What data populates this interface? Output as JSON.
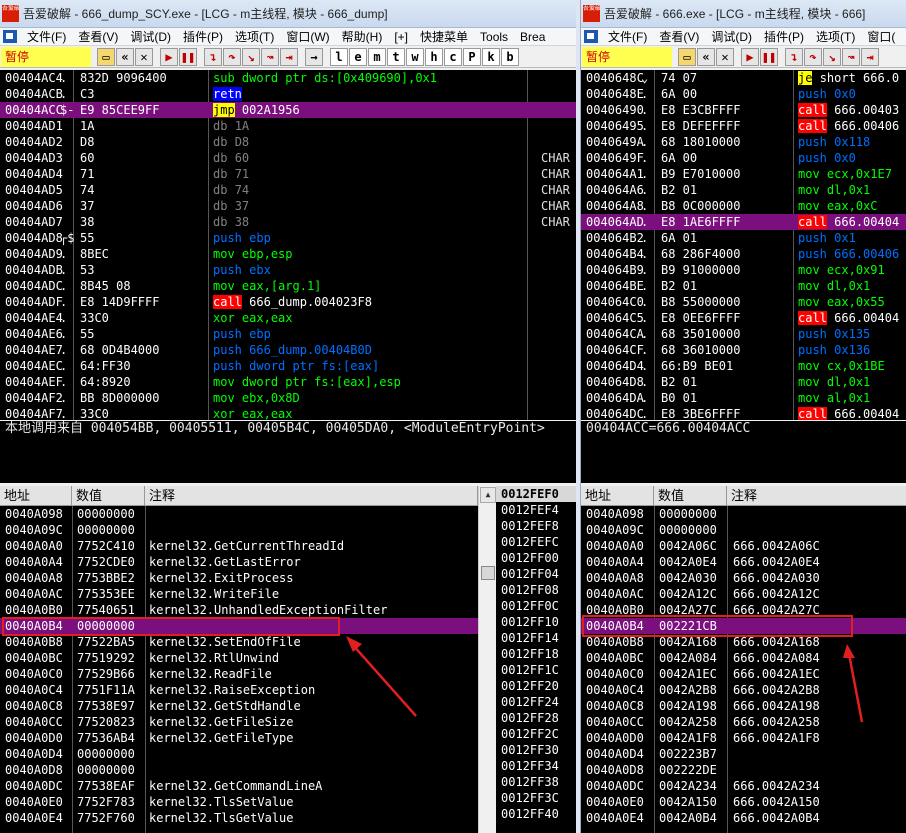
{
  "left": {
    "title": "吾爱破解 - 666_dump_SCY.exe - [LCG - m主线程, 模块 - 666_dump]",
    "logo_text": "吾爱破解",
    "menu": [
      "文件(F)",
      "查看(V)",
      "调试(D)",
      "插件(P)",
      "选项(T)",
      "窗口(W)",
      "帮助(H)",
      "[+]",
      "快捷菜单",
      "Tools",
      "Brea"
    ],
    "status": "暂停",
    "toolbar_letters": [
      "l",
      "e",
      "m",
      "t",
      "w",
      "h",
      "c",
      "P",
      "k",
      "b"
    ],
    "cpu_rows": [
      {
        "addr": "00404AC4",
        "mark": ".",
        "hex": "832D 9096400",
        "op": "sub",
        "args": "dword ptr ds:[0x409690],0x1",
        "cmt": ""
      },
      {
        "addr": "00404ACB",
        "mark": ".",
        "hex": "C3",
        "op": "retn",
        "args": "",
        "cmt": ""
      },
      {
        "addr": "00404ACC",
        "mark": "$-",
        "hex": "E9 85CEE9FF",
        "op": "jmp",
        "args": "002A1956",
        "cmt": ""
      },
      {
        "addr": "00404AD1",
        "mark": "",
        "hex": "1A",
        "op": "db",
        "args": "1A",
        "cmt": ""
      },
      {
        "addr": "00404AD2",
        "mark": "",
        "hex": "D8",
        "op": "db",
        "args": "D8",
        "cmt": ""
      },
      {
        "addr": "00404AD3",
        "mark": "",
        "hex": "60",
        "op": "db",
        "args": "60",
        "cmt": "CHAR"
      },
      {
        "addr": "00404AD4",
        "mark": "",
        "hex": "71",
        "op": "db",
        "args": "71",
        "cmt": "CHAR"
      },
      {
        "addr": "00404AD5",
        "mark": "",
        "hex": "74",
        "op": "db",
        "args": "74",
        "cmt": "CHAR"
      },
      {
        "addr": "00404AD6",
        "mark": "",
        "hex": "37",
        "op": "db",
        "args": "37",
        "cmt": "CHAR"
      },
      {
        "addr": "00404AD7",
        "mark": "",
        "hex": "38",
        "op": "db",
        "args": "38",
        "cmt": "CHAR"
      },
      {
        "addr": "00404AD8",
        "mark": "┌$",
        "hex": "55",
        "op": "push",
        "args": "ebp",
        "cmt": ""
      },
      {
        "addr": "00404AD9",
        "mark": ".",
        "hex": "8BEC",
        "op": "mov",
        "args": "ebp,esp",
        "cmt": ""
      },
      {
        "addr": "00404ADB",
        "mark": ".",
        "hex": "53",
        "op": "push",
        "args": "ebx",
        "cmt": ""
      },
      {
        "addr": "00404ADC",
        "mark": ".",
        "hex": "8B45 08",
        "op": "mov",
        "args": "eax,[arg.1]",
        "cmt": ""
      },
      {
        "addr": "00404ADF",
        "mark": ".",
        "hex": "E8 14D9FFFF",
        "op": "call",
        "args": "666_dump.004023F8",
        "cmt": ""
      },
      {
        "addr": "00404AE4",
        "mark": ".",
        "hex": "33C0",
        "op": "xor",
        "args": "eax,eax",
        "cmt": ""
      },
      {
        "addr": "00404AE6",
        "mark": ".",
        "hex": "55",
        "op": "push",
        "args": "ebp",
        "cmt": ""
      },
      {
        "addr": "00404AE7",
        "mark": ".",
        "hex": "68 0D4B4000",
        "op": "push",
        "args": "666_dump.00404B0D",
        "cmt": ""
      },
      {
        "addr": "00404AEC",
        "mark": ".",
        "hex": "64:FF30",
        "op": "push",
        "args": "dword ptr fs:[eax]",
        "cmt": ""
      },
      {
        "addr": "00404AEF",
        "mark": ".",
        "hex": "64:8920",
        "op": "mov",
        "args": "dword ptr fs:[eax],esp",
        "cmt": ""
      },
      {
        "addr": "00404AF2",
        "mark": ".",
        "hex": "BB 8D000000",
        "op": "mov",
        "args": "ebx,0x8D",
        "cmt": ""
      },
      {
        "addr": "00404AF7",
        "mark": ".",
        "hex": "33C0",
        "op": "xor",
        "args": "eax,eax",
        "cmt": ""
      }
    ],
    "cpu_selected": 2,
    "info": "本地调用来自  004054BB, 00405511, 00405B4C, 00405DA0, <ModuleEntryPoint>",
    "dump_headers": [
      "地址",
      "数值",
      "注释"
    ],
    "dump_rows": [
      {
        "a": "0040A098",
        "v": "00000000",
        "c": ""
      },
      {
        "a": "0040A09C",
        "v": "00000000",
        "c": ""
      },
      {
        "a": "0040A0A0",
        "v": "7752C410",
        "c": "kernel32.GetCurrentThreadId"
      },
      {
        "a": "0040A0A4",
        "v": "7752CDE0",
        "c": "kernel32.GetLastError"
      },
      {
        "a": "0040A0A8",
        "v": "7753BBE2",
        "c": "kernel32.ExitProcess"
      },
      {
        "a": "0040A0AC",
        "v": "775353EE",
        "c": "kernel32.WriteFile"
      },
      {
        "a": "0040A0B0",
        "v": "77540651",
        "c": "kernel32.UnhandledExceptionFilter"
      },
      {
        "a": "0040A0B4",
        "v": "00000000",
        "c": ""
      },
      {
        "a": "0040A0B8",
        "v": "77522BA5",
        "c": "kernel32.SetEndOfFile"
      },
      {
        "a": "0040A0BC",
        "v": "77519292",
        "c": "kernel32.RtlUnwind"
      },
      {
        "a": "0040A0C0",
        "v": "77529B66",
        "c": "kernel32.ReadFile"
      },
      {
        "a": "0040A0C4",
        "v": "7751F11A",
        "c": "kernel32.RaiseException"
      },
      {
        "a": "0040A0C8",
        "v": "77538E97",
        "c": "kernel32.GetStdHandle"
      },
      {
        "a": "0040A0CC",
        "v": "77520823",
        "c": "kernel32.GetFileSize"
      },
      {
        "a": "0040A0D0",
        "v": "77536AB4",
        "c": "kernel32.GetFileType"
      },
      {
        "a": "0040A0D4",
        "v": "00000000",
        "c": ""
      },
      {
        "a": "0040A0D8",
        "v": "00000000",
        "c": ""
      },
      {
        "a": "0040A0DC",
        "v": "77538EAF",
        "c": "kernel32.GetCommandLineA"
      },
      {
        "a": "0040A0E0",
        "v": "7752F783",
        "c": "kernel32.TlsSetValue"
      },
      {
        "a": "0040A0E4",
        "v": "7752F760",
        "c": "kernel32.TlsGetValue"
      }
    ],
    "dump_selected": 7,
    "stack_rows": [
      "0012FEF0",
      "0012FEF4",
      "0012FEF8",
      "0012FEFC",
      "0012FF00",
      "0012FF04",
      "0012FF08",
      "0012FF0C",
      "0012FF10",
      "0012FF14",
      "0012FF18",
      "0012FF1C",
      "0012FF20",
      "0012FF24",
      "0012FF28",
      "0012FF2C",
      "0012FF30",
      "0012FF34",
      "0012FF38",
      "0012FF3C",
      "0012FF40"
    ]
  },
  "right": {
    "title": "吾爱破解 - 666.exe - [LCG - m主线程, 模块 - 666]",
    "logo_text": "吾爱破解",
    "menu": [
      "文件(F)",
      "查看(V)",
      "调试(D)",
      "插件(P)",
      "选项(T)",
      "窗口("
    ],
    "status": "暂停",
    "cpu_rows": [
      {
        "addr": "0040648C",
        "mark": "⌄",
        "hex": "74 07",
        "op": "je",
        "args": "short 666.0"
      },
      {
        "addr": "0040648E",
        "mark": ".",
        "hex": "6A 00",
        "op": "push",
        "args": "0x0"
      },
      {
        "addr": "00406490",
        "mark": ".",
        "hex": "E8 E3CBFFFF",
        "op": "call",
        "args": "666.00403"
      },
      {
        "addr": "00406495",
        "mark": ".",
        "hex": "E8 DEFEFFFF",
        "op": "call",
        "args": "666.00406"
      },
      {
        "addr": "0040649A",
        "mark": ".",
        "hex": "68 18010000",
        "op": "push",
        "args": "0x118"
      },
      {
        "addr": "0040649F",
        "mark": ".",
        "hex": "6A 00",
        "op": "push",
        "args": "0x0"
      },
      {
        "addr": "004064A1",
        "mark": ".",
        "hex": "B9 E7010000",
        "op": "mov",
        "args": "ecx,0x1E7"
      },
      {
        "addr": "004064A6",
        "mark": ".",
        "hex": "B2 01",
        "op": "mov",
        "args": "dl,0x1"
      },
      {
        "addr": "004064A8",
        "mark": ".",
        "hex": "B8 0C000000",
        "op": "mov",
        "args": "eax,0xC"
      },
      {
        "addr": "004064AD",
        "mark": ".",
        "hex": "E8 1AE6FFFF",
        "op": "call",
        "args": "666.00404"
      },
      {
        "addr": "004064B2",
        "mark": ".",
        "hex": "6A 01",
        "op": "push",
        "args": "0x1"
      },
      {
        "addr": "004064B4",
        "mark": ".",
        "hex": "68 286F4000",
        "op": "push",
        "args": "666.00406"
      },
      {
        "addr": "004064B9",
        "mark": ".",
        "hex": "B9 91000000",
        "op": "mov",
        "args": "ecx,0x91"
      },
      {
        "addr": "004064BE",
        "mark": ".",
        "hex": "B2 01",
        "op": "mov",
        "args": "dl,0x1"
      },
      {
        "addr": "004064C0",
        "mark": ".",
        "hex": "B8 55000000",
        "op": "mov",
        "args": "eax,0x55"
      },
      {
        "addr": "004064C5",
        "mark": ".",
        "hex": "E8 0EE6FFFF",
        "op": "call",
        "args": "666.00404"
      },
      {
        "addr": "004064CA",
        "mark": ".",
        "hex": "68 35010000",
        "op": "push",
        "args": "0x135"
      },
      {
        "addr": "004064CF",
        "mark": ".",
        "hex": "68 36010000",
        "op": "push",
        "args": "0x136"
      },
      {
        "addr": "004064D4",
        "mark": ".",
        "hex": "66:B9 BE01",
        "op": "mov",
        "args": "cx,0x1BE"
      },
      {
        "addr": "004064D8",
        "mark": ".",
        "hex": "B2 01",
        "op": "mov",
        "args": "dl,0x1"
      },
      {
        "addr": "004064DA",
        "mark": ".",
        "hex": "B0 01",
        "op": "mov",
        "args": "al,0x1"
      },
      {
        "addr": "004064DC",
        "mark": ".",
        "hex": "E8 3BE6FFFF",
        "op": "call",
        "args": "666.00404"
      }
    ],
    "cpu_selected": 9,
    "info": "00404ACC=666.00404ACC",
    "dump_headers": [
      "地址",
      "数值",
      "注释"
    ],
    "dump_rows": [
      {
        "a": "0040A098",
        "v": "00000000",
        "c": ""
      },
      {
        "a": "0040A09C",
        "v": "00000000",
        "c": ""
      },
      {
        "a": "0040A0A0",
        "v": "0042A06C",
        "c": "666.0042A06C"
      },
      {
        "a": "0040A0A4",
        "v": "0042A0E4",
        "c": "666.0042A0E4"
      },
      {
        "a": "0040A0A8",
        "v": "0042A030",
        "c": "666.0042A030"
      },
      {
        "a": "0040A0AC",
        "v": "0042A12C",
        "c": "666.0042A12C"
      },
      {
        "a": "0040A0B0",
        "v": "0042A27C",
        "c": "666.0042A27C"
      },
      {
        "a": "0040A0B4",
        "v": "002221CB",
        "c": ""
      },
      {
        "a": "0040A0B8",
        "v": "0042A168",
        "c": "666.0042A168"
      },
      {
        "a": "0040A0BC",
        "v": "0042A084",
        "c": "666.0042A084"
      },
      {
        "a": "0040A0C0",
        "v": "0042A1EC",
        "c": "666.0042A1EC"
      },
      {
        "a": "0040A0C4",
        "v": "0042A2B8",
        "c": "666.0042A2B8"
      },
      {
        "a": "0040A0C8",
        "v": "0042A198",
        "c": "666.0042A198"
      },
      {
        "a": "0040A0CC",
        "v": "0042A258",
        "c": "666.0042A258"
      },
      {
        "a": "0040A0D0",
        "v": "0042A1F8",
        "c": "666.0042A1F8"
      },
      {
        "a": "0040A0D4",
        "v": "002223B7",
        "c": ""
      },
      {
        "a": "0040A0D8",
        "v": "002222DE",
        "c": ""
      },
      {
        "a": "0040A0DC",
        "v": "0042A234",
        "c": "666.0042A234"
      },
      {
        "a": "0040A0E0",
        "v": "0042A150",
        "c": "666.0042A150"
      },
      {
        "a": "0040A0E4",
        "v": "0042A0B4",
        "c": "666.0042A0B4"
      }
    ],
    "dump_selected": 7
  },
  "colors": {
    "selection": "#7b0f7e",
    "call_bg": "#ff0000",
    "jmp_bg": "#ffff00",
    "push_fg": "#0070ff",
    "annotation": "#e02020"
  }
}
